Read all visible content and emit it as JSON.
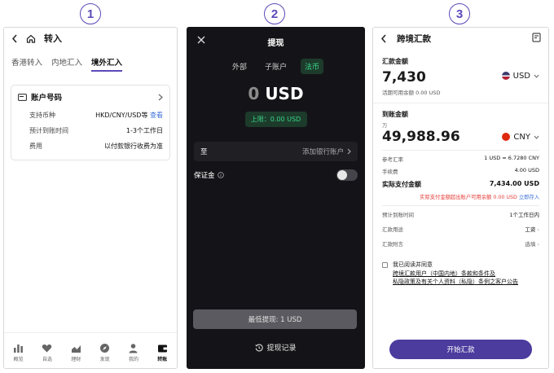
{
  "steps": [
    "1",
    "2",
    "3"
  ],
  "phone1": {
    "title": "转入",
    "tabs": [
      "香港转入",
      "内地汇入",
      "境外汇入"
    ],
    "active_tab": 2,
    "card": {
      "title": "账户号码",
      "rows": [
        {
          "label": "支持币种",
          "value": "HKD/CNY/USD等",
          "link": "查看"
        },
        {
          "label": "预计到账时间",
          "value": "1-3个工作日"
        },
        {
          "label": "费用",
          "value": "以付款银行收费为准"
        }
      ]
    },
    "nav": [
      {
        "label": "概览",
        "icon": "bar-chart-icon"
      },
      {
        "label": "自选",
        "icon": "heart-icon"
      },
      {
        "label": "理财",
        "icon": "trend-chart-icon"
      },
      {
        "label": "发现",
        "icon": "compass-icon"
      },
      {
        "label": "我的",
        "icon": "person-icon"
      },
      {
        "label": "转账",
        "icon": "wallet-icon"
      }
    ]
  },
  "phone2": {
    "title": "提现",
    "tabs": [
      "外部",
      "子账户",
      "法币"
    ],
    "active_tab": 2,
    "amount_zero": "0",
    "amount_currency": "USD",
    "limit": "上限：0.00 USD",
    "to_label": "至",
    "to_value": "添加银行账户",
    "deposit_label": "保证金",
    "min_button": "最低提现: 1 USD",
    "history": "提现记录"
  },
  "phone3": {
    "title": "跨境汇款",
    "send_label": "汇款金额",
    "send_amount": "7,430",
    "send_currency": "USD",
    "send_hint": "活期可用余额 0.00 USD",
    "receive_label": "到账金额",
    "receive_unit": "万",
    "receive_amount": "49,988.96",
    "receive_currency": "CNY",
    "rows": [
      {
        "label": "参考汇率",
        "value": "1 USD ≈ 6.7280 CNY"
      },
      {
        "label": "手续费",
        "value": "4.00 USD"
      }
    ],
    "total_label": "实际支付金额",
    "total_value": "7,434.00 USD",
    "warning": "实际支付金额超出账户可用余额 0.00 USD",
    "warning_link": "立即存入",
    "details": [
      {
        "label": "预计到账时间",
        "value": "1个工作日内"
      },
      {
        "label": "汇款用途",
        "value": "工资"
      },
      {
        "label": "汇款附言",
        "value": "选填"
      }
    ],
    "agree_lead": "我已阅读并同意",
    "agree_line1": "跨境汇款用户（中国内地）条款和条件及",
    "agree_line2": "私隐政策及有关个人资料（私隐）条例之客户公告",
    "button": "开始汇款"
  },
  "colors": {
    "accent": "#4b3c9e",
    "green": "#39d68a",
    "red": "#e53935",
    "link": "#3b6fd8"
  }
}
